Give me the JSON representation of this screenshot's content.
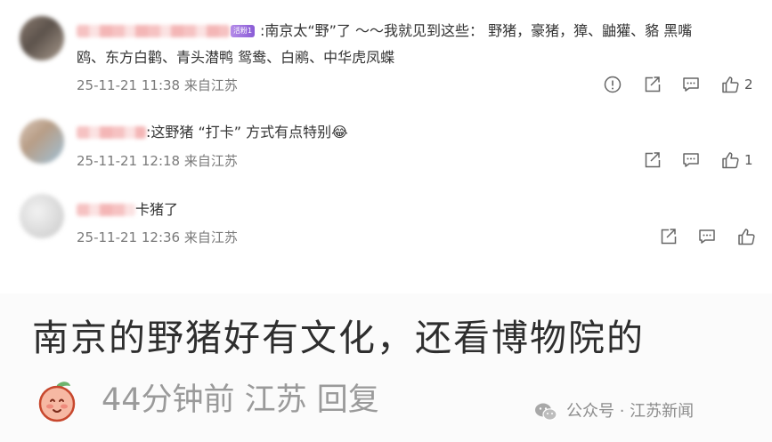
{
  "comments": [
    {
      "badge": "活粉1",
      "text_line1": ":南京太“野”了 ～～我就见到这些： 野猪，豪猪，獐、鼬獾、貉 黑嘴",
      "text_line2": "鸥、东方白鹳、青头潜鸭 鸳鸯、白鹇、中华虎凤蝶",
      "meta": "25-11-21 11:38 来自江苏",
      "likes": "2"
    },
    {
      "text": ":这野猪 “打卡” 方式有点特别",
      "emoji": "😂",
      "meta": "25-11-21 12:18 来自江苏",
      "likes": "1"
    },
    {
      "text": "卡猪了",
      "meta": "25-11-21 12:36 来自江苏",
      "likes": ""
    }
  ],
  "banner": {
    "title": "南京的野猪好有文化，还看博物院的",
    "meta": "44分钟前 江苏 回复"
  },
  "watermark": {
    "text": "公众号 · 江苏新闻"
  },
  "colors": {
    "text": "#333333",
    "meta": "#7a7a7a",
    "badge": "#8a5cd6",
    "icon": "#666666"
  }
}
